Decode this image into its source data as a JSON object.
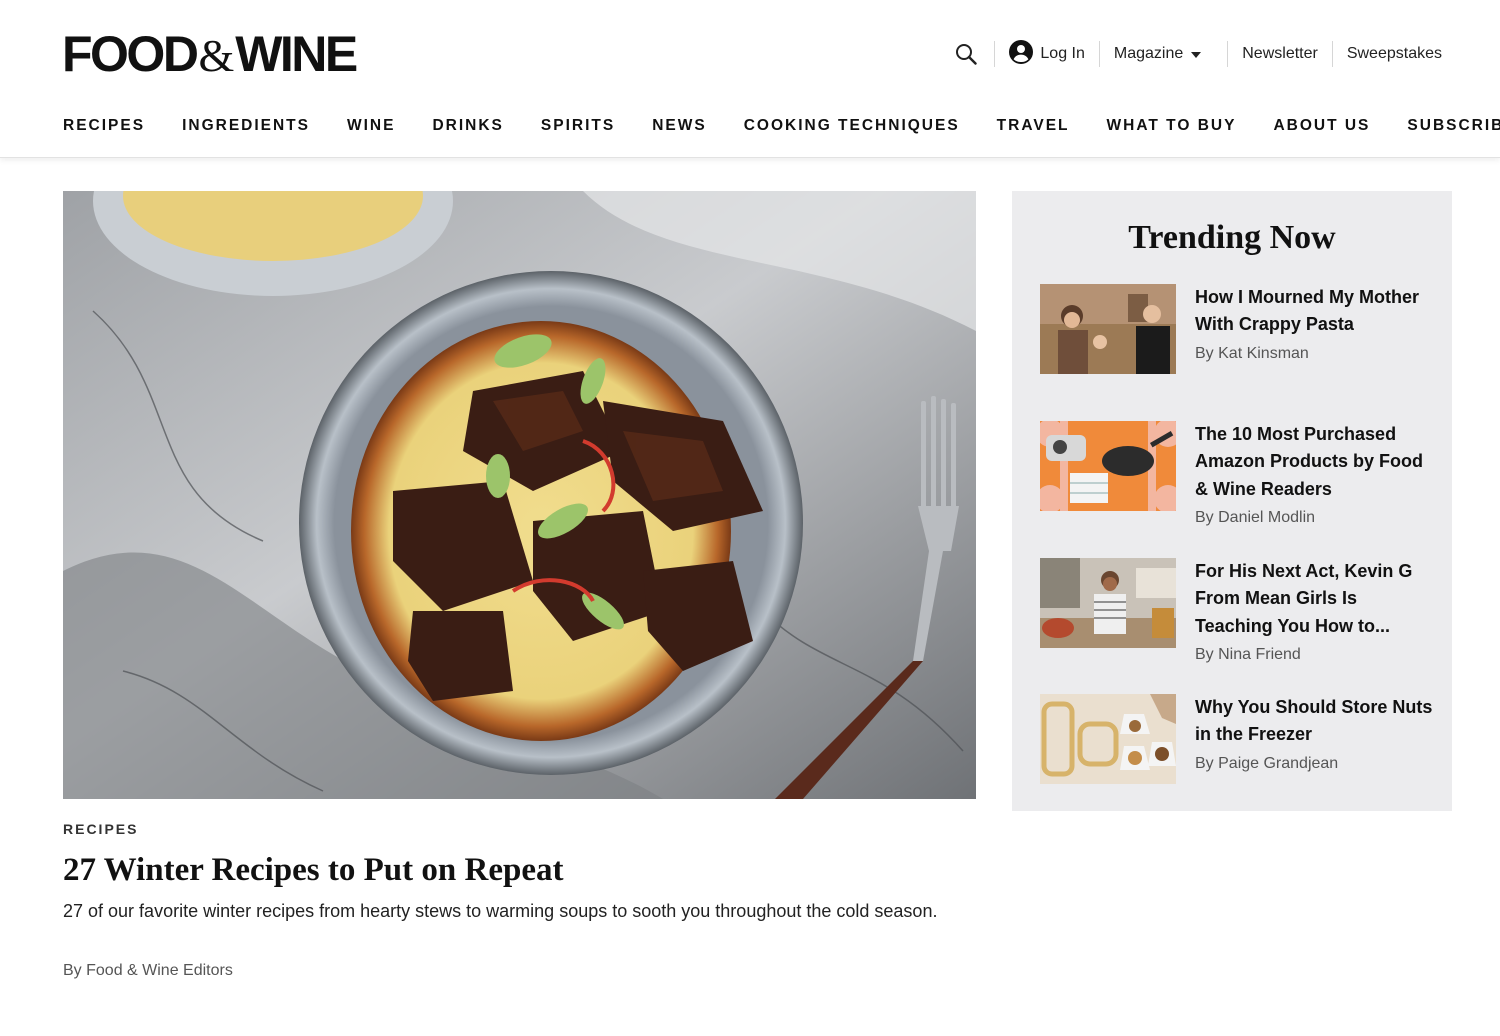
{
  "brand": {
    "logo_part1": "FOOD",
    "logo_amp": "&",
    "logo_part2": "WINE"
  },
  "utility_nav": {
    "search_icon": "search-icon",
    "login_label": "Log In",
    "magazine_label": "Magazine",
    "newsletter_label": "Newsletter",
    "sweepstakes_label": "Sweepstakes"
  },
  "main_nav": {
    "items": [
      "RECIPES",
      "INGREDIENTS",
      "WINE",
      "DRINKS",
      "SPIRITS",
      "NEWS",
      "COOKING TECHNIQUES",
      "TRAVEL",
      "WHAT TO BUY",
      "ABOUT US"
    ],
    "subscribe_label": "SUBSCRIBE"
  },
  "feature": {
    "kicker": "RECIPES",
    "title": "27 Winter Recipes to Put on Repeat",
    "description": "27 of our favorite winter recipes from hearty stews to warming soups to sooth you throughout the cold season.",
    "byline": "By Food & Wine Editors"
  },
  "trending": {
    "heading": "Trending Now",
    "items": [
      {
        "title": "How I Mourned My Mother With Crappy Pasta",
        "byline": "By Kat Kinsman"
      },
      {
        "title": "The 10 Most Purchased Amazon Products by Food & Wine Readers",
        "byline": "By Daniel Modlin"
      },
      {
        "title": "For His Next Act, Kevin G From Mean Girls Is Teaching You How to...",
        "byline": "By Nina Friend"
      },
      {
        "title": "Why You Should Store Nuts in the Freezer",
        "byline": "By Paige Grandjean"
      }
    ]
  },
  "colors": {
    "text": "#111111",
    "muted": "#555555",
    "panel": "#ececee"
  }
}
